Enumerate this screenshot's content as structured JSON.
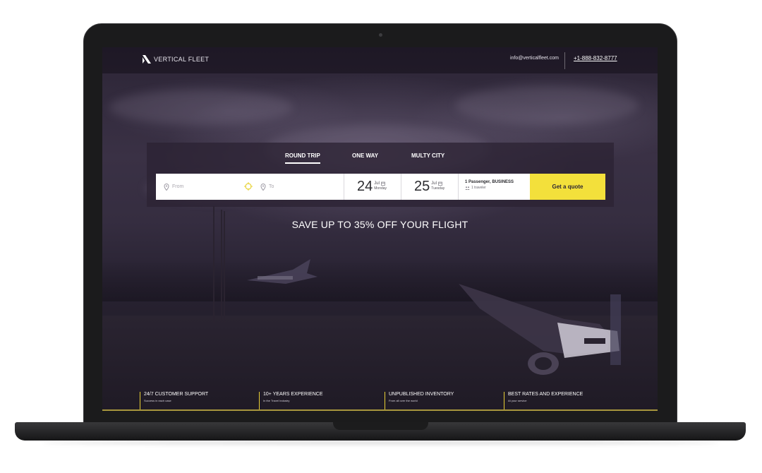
{
  "header": {
    "logo_text": "VERTICAL FLEET",
    "email": "info@verticalfleet.com",
    "phone": "+1-888-832-8777"
  },
  "search": {
    "tabs": [
      {
        "label": "ROUND TRIP",
        "active": true
      },
      {
        "label": "ONE WAY",
        "active": false
      },
      {
        "label": "MULTY CITY",
        "active": false
      }
    ],
    "from_placeholder": "From",
    "to_placeholder": "To",
    "depart": {
      "day": "24",
      "month": "Jul",
      "weekday": "Monday"
    },
    "return": {
      "day": "25",
      "month": "Jul",
      "weekday": "Tuesday"
    },
    "passengers_label": "1 Passenger, BUSINESS",
    "travelers_label": "1 traveler",
    "quote_button": "Get a quote"
  },
  "promo": "SAVE UP TO 35% OFF YOUR FLIGHT",
  "features": [
    {
      "title": "24/7 CUSTOMER SUPPORT",
      "subtitle": "Success in each case"
    },
    {
      "title": "10+ YEARS EXPERIENCE",
      "subtitle": "In the Travel Industry"
    },
    {
      "title": "UNPUBLISHED INVENTORY",
      "subtitle": "From all over the world"
    },
    {
      "title": "BEST RATES AND EXPERIENCE",
      "subtitle": "At your service"
    }
  ],
  "colors": {
    "accent": "#f3e03b",
    "overlay": "#2b2333",
    "frame": "#1b1b1c"
  },
  "icons": [
    "logo-mark-icon",
    "location-pin-icon",
    "swap-icon",
    "calendar-icon",
    "person-icon"
  ]
}
